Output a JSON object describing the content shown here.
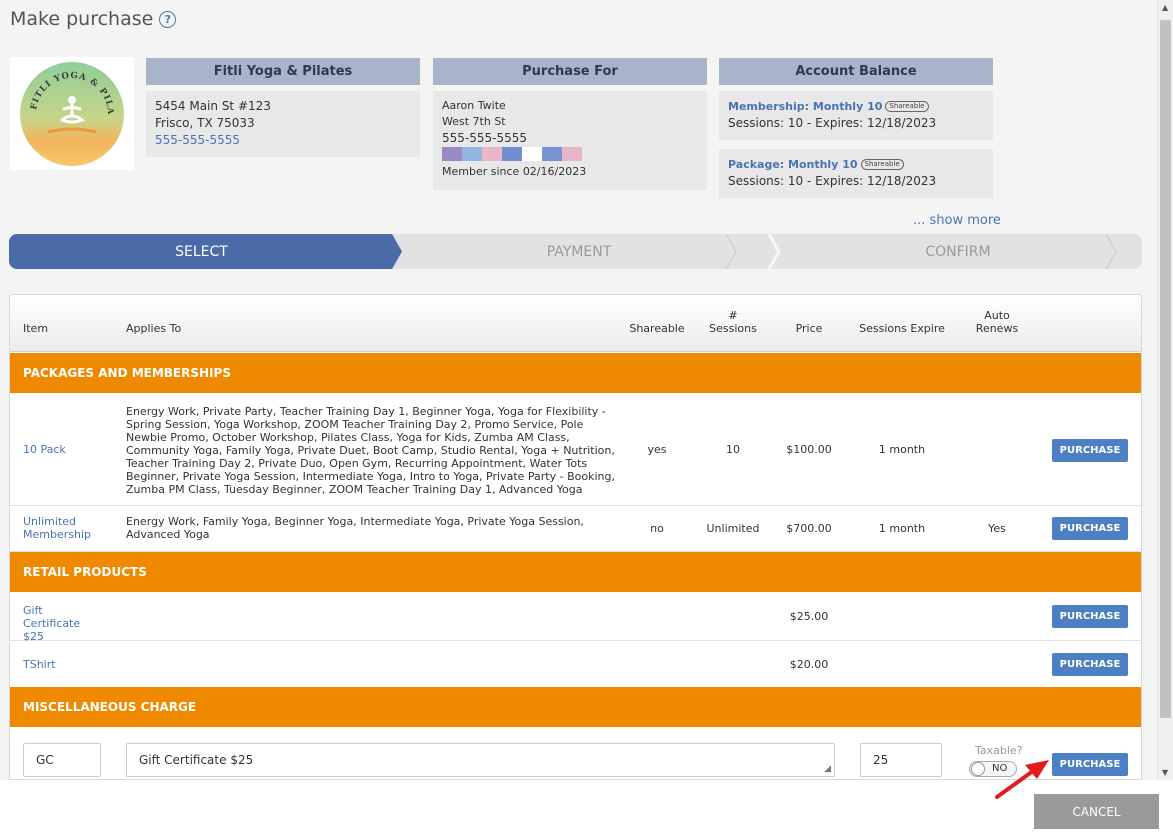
{
  "page": {
    "title": "Make purchase"
  },
  "logo": {
    "text": "FITLI YOGA & PILATES"
  },
  "studio": {
    "header": "Fitli Yoga & Pilates",
    "address1": "5454 Main St #123",
    "address2": "Frisco, TX 75033",
    "phone": "555-555-5555"
  },
  "purchase_for": {
    "header": "Purchase For",
    "name": "Aaron Twite",
    "street": "West 7th St",
    "phone": "555-555-5555",
    "swatch_colors": [
      "#9b89c4",
      "#8fb7e0",
      "#e7b6c8",
      "#6f8fcf",
      "#ffffff",
      "#7a93d2",
      "#e7b6c8"
    ],
    "member_since": "Member since 02/16/2023"
  },
  "account_balance": {
    "header": "Account Balance",
    "items": [
      {
        "title": "Membership: Monthly 10",
        "badge": "Shareable",
        "sessions": "Sessions: 10 -",
        "expires": "Expires: 12/18/2023"
      },
      {
        "title": "Package: Monthly 10",
        "badge": "Shareable",
        "sessions": "Sessions: 10 -",
        "expires": "Expires: 12/18/2023"
      }
    ],
    "show_more": "... show more"
  },
  "steps": [
    "SELECT",
    "PAYMENT",
    "CONFIRM"
  ],
  "table": {
    "columns": {
      "item": "Item",
      "applies_to": "Applies To",
      "shareable": "Shareable",
      "sessions_1": "#",
      "sessions_2": "Sessions",
      "price": "Price",
      "sessions_expire": "Sessions Expire",
      "auto_renews_1": "Auto",
      "auto_renews_2": "Renews"
    },
    "sections": {
      "packages": "PACKAGES AND MEMBERSHIPS",
      "retail": "RETAIL PRODUCTS",
      "misc": "MISCELLANEOUS CHARGE"
    },
    "rows": [
      {
        "item": "10 Pack",
        "applies_to": "Energy Work, Private Party, Teacher Training Day 1, Beginner Yoga, Yoga for Flexibility - Spring Session, Yoga Workshop, ZOOM Teacher Training Day 2, Promo Service, Pole Newbie Promo, October Workshop, Pilates Class, Yoga for Kids, Zumba AM Class, Community Yoga, Family Yoga, Private Duet, Boot Camp, Studio Rental, Yoga + Nutrition, Teacher Training Day 2, Private Duo, Open Gym, Recurring Appointment, Water Tots Beginner, Private Yoga Session, Intermediate Yoga, Intro to Yoga, Private Party - Booking, Zumba PM Class, Tuesday Beginner, ZOOM Teacher Training Day 1, Advanced Yoga",
        "shareable": "yes",
        "sessions": "10",
        "price": "$100.00",
        "expire": "1 month",
        "auto": ""
      },
      {
        "item": "Unlimited Membership",
        "applies_to": "Energy Work, Family Yoga, Beginner Yoga, Intermediate Yoga, Private Yoga Session, Advanced Yoga",
        "shareable": "no",
        "sessions": "Unlimited",
        "price": "$700.00",
        "expire": "1 month",
        "auto": "Yes"
      }
    ],
    "retail_rows": [
      {
        "item": "Gift Certificate $25",
        "price": "$25.00"
      },
      {
        "item": "TShirt",
        "price": "$20.00"
      }
    ],
    "misc": {
      "code": "GC",
      "description": "Gift Certificate $25",
      "amount": "25",
      "taxable_label": "Taxable?",
      "taxable_value": "NO"
    },
    "purchase_label": "PURCHASE"
  },
  "footer": {
    "cancel_label": "CANCEL"
  },
  "colors": {
    "accent": "#4d7fc4",
    "section": "#ef8a00",
    "step_active": "#4a6ba8"
  }
}
